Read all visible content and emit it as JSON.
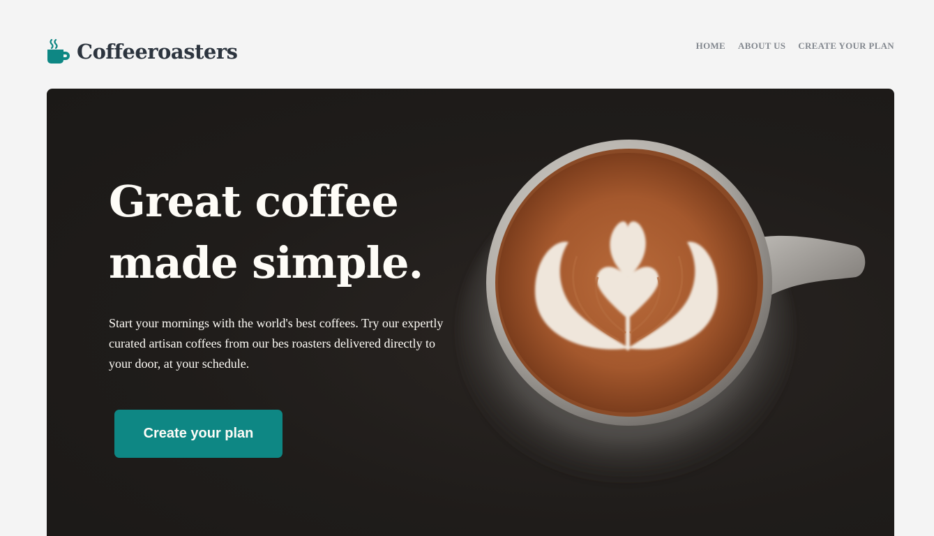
{
  "brand": {
    "name": "Coffeeroasters",
    "icon": "coffee-cup-icon",
    "accent_color": "#0e8784"
  },
  "nav": {
    "items": [
      {
        "label": "HOME"
      },
      {
        "label": "ABOUT US"
      },
      {
        "label": "CREATE YOUR PLAN"
      }
    ]
  },
  "hero": {
    "headline_line1": "Great coffee",
    "headline_line2": "made simple.",
    "description": "Start your mornings with the world's best coffees. Try our expertly curated artisan coffees from our bes roasters delivered directly to your door, at your schedule.",
    "cta_label": "Create your plan",
    "image": "latte-art-coffee-cup"
  }
}
